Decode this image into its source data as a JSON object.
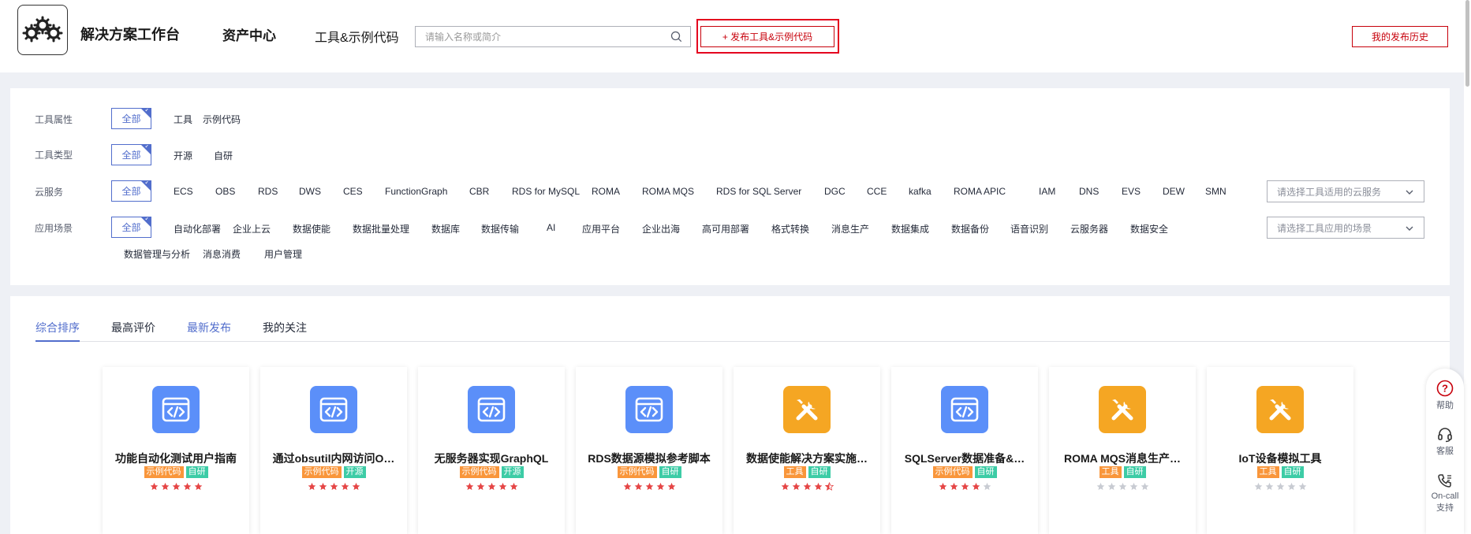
{
  "header": {
    "brand": "解决方案工作台",
    "nav_asset": "资产中心",
    "nav_tools": "工具&示例代码",
    "search_placeholder": "请输入名称或简介",
    "publish_label": "+ 发布工具&示例代码",
    "history_label": "我的发布历史"
  },
  "filters": {
    "all_label": "全部",
    "rows": [
      {
        "label": "工具属性",
        "options": [
          "工具",
          "示例代码"
        ]
      },
      {
        "label": "工具类型",
        "options": [
          "开源",
          "自研"
        ]
      },
      {
        "label": "云服务",
        "options": [
          "ECS",
          "OBS",
          "RDS",
          "DWS",
          "CES",
          "FunctionGraph",
          "CBR",
          "RDS for MySQL",
          "ROMA",
          "ROMA MQS",
          "RDS for SQL Server",
          "DGC",
          "CCE",
          "kafka",
          "ROMA APIC",
          "IAM",
          "DNS",
          "EVS",
          "DEW",
          "SMN"
        ],
        "dropdown_placeholder": "请选择工具适用的云服务"
      },
      {
        "label": "应用场景",
        "options": [
          "自动化部署",
          "企业上云",
          "数据使能",
          "数据批量处理",
          "数据库",
          "数据传输",
          "AI",
          "应用平台",
          "企业出海",
          "高可用部署",
          "格式转换",
          "消息生产",
          "数据集成",
          "数据备份",
          "语音识别",
          "云服务器",
          "数据安全"
        ],
        "options_line2": [
          "数据管理与分析",
          "消息消费",
          "用户管理"
        ],
        "dropdown_placeholder": "请选择工具应用的场景"
      }
    ]
  },
  "tabs": [
    "综合排序",
    "最高评价",
    "最新发布",
    "我的关注"
  ],
  "cards": [
    {
      "title": "功能自动化测试用户指南",
      "icon": "code-icon",
      "tags": [
        {
          "text": "示例代码",
          "color": "orange"
        },
        {
          "text": "自研",
          "color": "green"
        }
      ],
      "rating": 5
    },
    {
      "title": "通过obsutil内网访问O…",
      "icon": "code-icon",
      "tags": [
        {
          "text": "示例代码",
          "color": "orange"
        },
        {
          "text": "开源",
          "color": "green"
        }
      ],
      "rating": 5
    },
    {
      "title": "无服务器实现GraphQL",
      "icon": "code-icon",
      "tags": [
        {
          "text": "示例代码",
          "color": "orange"
        },
        {
          "text": "开源",
          "color": "green"
        }
      ],
      "rating": 5
    },
    {
      "title": "RDS数据源模拟参考脚本",
      "icon": "code-icon",
      "tags": [
        {
          "text": "示例代码",
          "color": "orange"
        },
        {
          "text": "自研",
          "color": "green"
        }
      ],
      "rating": 5
    },
    {
      "title": "数据使能解决方案实施…",
      "icon": "tools-icon",
      "tags": [
        {
          "text": "工具",
          "color": "orange"
        },
        {
          "text": "自研",
          "color": "green"
        }
      ],
      "rating": 4.5
    },
    {
      "title": "SQLServer数据准备&…",
      "icon": "code-icon",
      "tags": [
        {
          "text": "示例代码",
          "color": "orange"
        },
        {
          "text": "自研",
          "color": "green"
        }
      ],
      "rating": 4
    },
    {
      "title": "ROMA MQS消息生产…",
      "icon": "tools-icon",
      "tags": [
        {
          "text": "工具",
          "color": "orange"
        },
        {
          "text": "自研",
          "color": "green"
        }
      ],
      "rating": 0
    },
    {
      "title": "IoT设备模拟工具",
      "icon": "tools-icon",
      "tags": [
        {
          "text": "工具",
          "color": "orange"
        },
        {
          "text": "自研",
          "color": "green"
        }
      ],
      "rating": 0
    }
  ],
  "side": {
    "help": "帮助",
    "service": "客服",
    "oncall_1": "On-call",
    "oncall_2": "支持"
  },
  "colors": {
    "accent": "#526ecc",
    "brand_red": "#c7000b",
    "star_red": "#e54545",
    "star_gray": "#c8cbd2",
    "tag_orange": "#f9963b",
    "tag_green": "#3dcca6",
    "code_icon_bg": "#5b8ff9",
    "tools_icon_bg": "#f5a623"
  }
}
